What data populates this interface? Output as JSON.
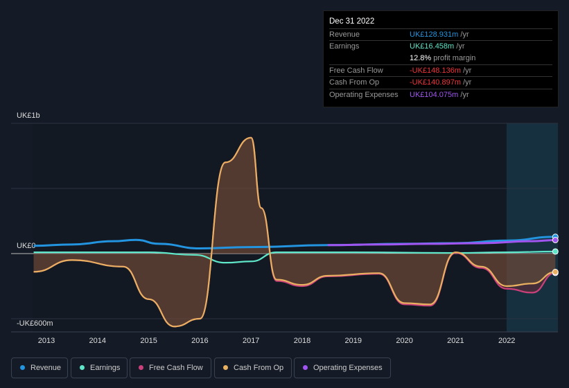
{
  "tooltip": {
    "date": "Dec 31 2022",
    "rows": [
      {
        "label": "Revenue",
        "value": "UK£128.931m",
        "unit": "/yr",
        "color": "#2394df"
      },
      {
        "label": "Earnings",
        "value": "UK£16.458m",
        "unit": "/yr",
        "color": "#5fe5c8"
      },
      {
        "label": "",
        "value": "12.8%",
        "unit": "profit margin",
        "color": "#ffffff"
      },
      {
        "label": "Free Cash Flow",
        "value": "-UK£148.136m",
        "unit": "/yr",
        "color": "#f0353c"
      },
      {
        "label": "Cash From Op",
        "value": "-UK£140.897m",
        "unit": "/yr",
        "color": "#f0353c"
      },
      {
        "label": "Operating Expenses",
        "value": "UK£104.075m",
        "unit": "/yr",
        "color": "#a155f0"
      }
    ]
  },
  "legend": [
    {
      "label": "Revenue",
      "color": "#2394df"
    },
    {
      "label": "Earnings",
      "color": "#5fe5c8"
    },
    {
      "label": "Free Cash Flow",
      "color": "#c9407a"
    },
    {
      "label": "Cash From Op",
      "color": "#e8b060"
    },
    {
      "label": "Operating Expenses",
      "color": "#a155f0"
    }
  ],
  "chart_data": {
    "type": "line",
    "ylim": [
      -600,
      1000
    ],
    "y_tick_labels": [
      "UK£1b",
      "UK£0",
      "-UK£600m"
    ],
    "x_tick_labels": [
      "2013",
      "2014",
      "2015",
      "2016",
      "2017",
      "2018",
      "2019",
      "2020",
      "2021",
      "2022"
    ],
    "grid": true,
    "legend_position": "bottom",
    "series": [
      {
        "name": "Revenue",
        "color": "#2394df",
        "x": [
          2012.75,
          2013.5,
          2014.3,
          2014.75,
          2015.2,
          2016,
          2017,
          2018.5,
          2020,
          2021,
          2022,
          2022.95
        ],
        "values": [
          60,
          70,
          95,
          105,
          75,
          40,
          50,
          65,
          75,
          80,
          100,
          129
        ]
      },
      {
        "name": "Earnings",
        "color": "#5fe5c8",
        "x": [
          2012.75,
          2014,
          2015,
          2015.9,
          2016.5,
          2017,
          2017.5,
          2019,
          2021,
          2022,
          2022.95
        ],
        "values": [
          10,
          10,
          10,
          -10,
          -70,
          -60,
          10,
          10,
          5,
          10,
          16
        ]
      },
      {
        "name": "Free Cash Flow",
        "color": "#c9407a",
        "x": [
          2012.75,
          2013.5,
          2014.5,
          2015,
          2015.5,
          2016,
          2016.5,
          2017,
          2017.2,
          2017.5,
          2018,
          2018.5,
          2019.5,
          2020,
          2020.5,
          2021,
          2021.5,
          2022,
          2022.5,
          2022.95
        ],
        "values": [
          -140,
          -50,
          -100,
          -350,
          -560,
          -500,
          700,
          890,
          350,
          -210,
          -250,
          -175,
          -155,
          -390,
          -400,
          5,
          -110,
          -270,
          -300,
          -148
        ]
      },
      {
        "name": "Cash From Op",
        "color": "#e8b060",
        "x": [
          2012.75,
          2013.5,
          2014.5,
          2015,
          2015.5,
          2016,
          2016.5,
          2017,
          2017.2,
          2017.5,
          2018,
          2018.5,
          2019.5,
          2020,
          2020.5,
          2021,
          2021.5,
          2022,
          2022.5,
          2022.95
        ],
        "values": [
          -140,
          -50,
          -100,
          -350,
          -560,
          -500,
          700,
          890,
          350,
          -200,
          -240,
          -170,
          -150,
          -380,
          -390,
          10,
          -100,
          -250,
          -230,
          -141
        ]
      },
      {
        "name": "Operating Expenses",
        "color": "#a155f0",
        "x": [
          2018.5,
          2019.5,
          2020.5,
          2021.5,
          2022.5,
          2022.95
        ],
        "values": [
          65,
          70,
          75,
          80,
          95,
          104
        ]
      }
    ]
  }
}
